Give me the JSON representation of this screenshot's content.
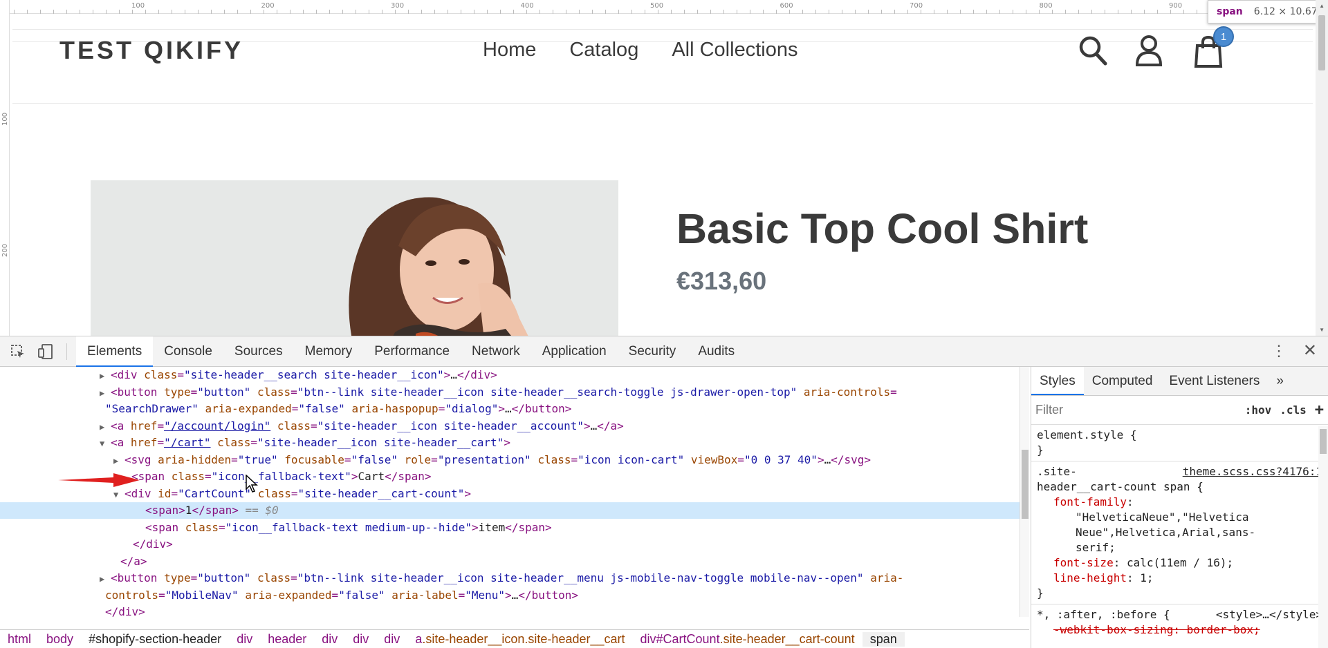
{
  "page": {
    "store_name": "TEST QIKIFY",
    "nav": [
      "Home",
      "Catalog",
      "All Collections"
    ],
    "cart_count": "1",
    "product_title": "Basic Top Cool Shirt",
    "product_price": "€313,60"
  },
  "rulers": {
    "top": [
      "100",
      "200",
      "300",
      "400",
      "500",
      "600",
      "700",
      "800",
      "900"
    ],
    "left": [
      "100",
      "200"
    ]
  },
  "inspector_tooltip": {
    "tag": "span",
    "dimensions": "6.12 × 10.67"
  },
  "devtools": {
    "tabs": [
      "Elements",
      "Console",
      "Sources",
      "Memory",
      "Performance",
      "Network",
      "Application",
      "Security",
      "Audits"
    ],
    "active_tab": "Elements",
    "dom_lines": [
      {
        "t": [
          [
            "tri",
            "▶"
          ],
          [
            "tag",
            "<div "
          ],
          [
            "attr",
            "class"
          ],
          [
            "tag",
            "="
          ],
          [
            "val",
            "\"site-header__search site-header__icon\""
          ],
          [
            "tag",
            ">"
          ],
          [
            "text",
            "…"
          ],
          [
            "tag",
            "</div>"
          ]
        ]
      },
      {
        "t": [
          [
            "tri",
            "▶"
          ],
          [
            "tag",
            "<button "
          ],
          [
            "attr",
            "type"
          ],
          [
            "tag",
            "="
          ],
          [
            "val",
            "\"button\""
          ],
          [
            "tag",
            " "
          ],
          [
            "attr",
            "class"
          ],
          [
            "tag",
            "="
          ],
          [
            "val",
            "\"btn--link site-header__icon site-header__search-toggle js-drawer-open-top\""
          ],
          [
            "tag",
            " "
          ],
          [
            "attr",
            "aria-controls"
          ],
          [
            "tag",
            "="
          ]
        ]
      },
      {
        "t": [
          [
            "val",
            "\"SearchDrawer\""
          ],
          [
            "tag",
            " "
          ],
          [
            "attr",
            "aria-expanded"
          ],
          [
            "tag",
            "="
          ],
          [
            "val",
            "\"false\""
          ],
          [
            "tag",
            " "
          ],
          [
            "attr",
            "aria-haspopup"
          ],
          [
            "tag",
            "="
          ],
          [
            "val",
            "\"dialog\""
          ],
          [
            "tag",
            ">"
          ],
          [
            "text",
            "…"
          ],
          [
            "tag",
            "</button>"
          ]
        ]
      },
      {
        "t": [
          [
            "tri",
            "▶"
          ],
          [
            "tag",
            "<a "
          ],
          [
            "attr",
            "href"
          ],
          [
            "tag",
            "="
          ],
          [
            "link",
            "\"/account/login\""
          ],
          [
            "tag",
            " "
          ],
          [
            "attr",
            "class"
          ],
          [
            "tag",
            "="
          ],
          [
            "val",
            "\"site-header__icon site-header__account\""
          ],
          [
            "tag",
            ">"
          ],
          [
            "text",
            "…"
          ],
          [
            "tag",
            "</a>"
          ]
        ]
      },
      {
        "t": [
          [
            "tri",
            "▼"
          ],
          [
            "tag",
            "<a "
          ],
          [
            "attr",
            "href"
          ],
          [
            "tag",
            "="
          ],
          [
            "link",
            "\"/cart\""
          ],
          [
            "tag",
            " "
          ],
          [
            "attr",
            "class"
          ],
          [
            "tag",
            "="
          ],
          [
            "val",
            "\"site-header__icon site-header__cart\""
          ],
          [
            "tag",
            ">"
          ]
        ]
      },
      {
        "t": [
          [
            "tri",
            "▶"
          ],
          [
            "tag",
            "<svg "
          ],
          [
            "attr",
            "aria-hidden"
          ],
          [
            "tag",
            "="
          ],
          [
            "val",
            "\"true\""
          ],
          [
            "tag",
            " "
          ],
          [
            "attr",
            "focusable"
          ],
          [
            "tag",
            "="
          ],
          [
            "val",
            "\"false\""
          ],
          [
            "tag",
            " "
          ],
          [
            "attr",
            "role"
          ],
          [
            "tag",
            "="
          ],
          [
            "val",
            "\"presentation\""
          ],
          [
            "tag",
            " "
          ],
          [
            "attr",
            "class"
          ],
          [
            "tag",
            "="
          ],
          [
            "val",
            "\"icon icon-cart\""
          ],
          [
            "tag",
            " "
          ],
          [
            "attr",
            "viewBox"
          ],
          [
            "tag",
            "="
          ],
          [
            "val",
            "\"0 0 37 40\""
          ],
          [
            "tag",
            ">"
          ],
          [
            "text",
            "…"
          ],
          [
            "tag",
            "</svg>"
          ]
        ]
      },
      {
        "t": [
          [
            "tag",
            "<span "
          ],
          [
            "attr",
            "class"
          ],
          [
            "tag",
            "="
          ],
          [
            "val",
            "\"icon__fallback-text\""
          ],
          [
            "tag",
            ">"
          ],
          [
            "text",
            "Cart"
          ],
          [
            "tag",
            "</span>"
          ]
        ]
      },
      {
        "t": [
          [
            "tri",
            "▼"
          ],
          [
            "tag",
            "<div "
          ],
          [
            "attr",
            "id"
          ],
          [
            "tag",
            "="
          ],
          [
            "val",
            "\"CartCount\""
          ],
          [
            "tag",
            " "
          ],
          [
            "attr",
            "class"
          ],
          [
            "tag",
            "="
          ],
          [
            "val",
            "\"site-header__cart-count\""
          ],
          [
            "tag",
            ">"
          ]
        ]
      },
      {
        "t": [
          [
            "tag",
            "<span>"
          ],
          [
            "text",
            "1"
          ],
          [
            "tag",
            "</span>"
          ],
          [
            "eq0",
            " == $0"
          ]
        ]
      },
      {
        "t": [
          [
            "tag",
            "<span "
          ],
          [
            "attr",
            "class"
          ],
          [
            "tag",
            "="
          ],
          [
            "val",
            "\"icon__fallback-text medium-up--hide\""
          ],
          [
            "tag",
            ">"
          ],
          [
            "text",
            "item"
          ],
          [
            "tag",
            "</span>"
          ]
        ]
      },
      {
        "t": [
          [
            "tag",
            "</div>"
          ]
        ]
      },
      {
        "t": [
          [
            "tag",
            "</a>"
          ]
        ]
      },
      {
        "t": [
          [
            "tri",
            "▶"
          ],
          [
            "tag",
            "<button "
          ],
          [
            "attr",
            "type"
          ],
          [
            "tag",
            "="
          ],
          [
            "val",
            "\"button\""
          ],
          [
            "tag",
            " "
          ],
          [
            "attr",
            "class"
          ],
          [
            "tag",
            "="
          ],
          [
            "val",
            "\"btn--link site-header__icon site-header__menu js-mobile-nav-toggle mobile-nav--open\""
          ],
          [
            "tag",
            " "
          ],
          [
            "attr",
            "aria-"
          ]
        ]
      },
      {
        "t": [
          [
            "attr",
            "controls"
          ],
          [
            "tag",
            "="
          ],
          [
            "val",
            "\"MobileNav\""
          ],
          [
            "tag",
            " "
          ],
          [
            "attr",
            "aria-expanded"
          ],
          [
            "tag",
            "="
          ],
          [
            "val",
            "\"false\""
          ],
          [
            "tag",
            " "
          ],
          [
            "attr",
            "aria-label"
          ],
          [
            "tag",
            "="
          ],
          [
            "val",
            "\"Menu\""
          ],
          [
            "tag",
            ">"
          ],
          [
            "text",
            "…"
          ],
          [
            "tag",
            "</button>"
          ]
        ]
      },
      {
        "t": [
          [
            "tag",
            "</div>"
          ]
        ]
      },
      {
        "t": [
          [
            "tag",
            "</div>"
          ]
        ]
      }
    ],
    "breadcrumbs": [
      {
        "tag": "html",
        "cls": ""
      },
      {
        "tag": "body",
        "cls": ""
      },
      {
        "tag": "#shopify-section-header",
        "cls": "",
        "plain": true
      },
      {
        "tag": "div",
        "cls": ""
      },
      {
        "tag": "header",
        "cls": ""
      },
      {
        "tag": "div",
        "cls": ""
      },
      {
        "tag": "div",
        "cls": ""
      },
      {
        "tag": "div",
        "cls": ""
      },
      {
        "tag": "a",
        "cls": ".site-header__icon.site-header__cart"
      },
      {
        "tag": "div#CartCount",
        "cls": ".site-header__cart-count"
      },
      {
        "tag": "span",
        "cls": "",
        "current": true
      }
    ],
    "styles_tabs": [
      "Styles",
      "Computed",
      "Event Listeners",
      "»"
    ],
    "filter_placeholder": "Filter",
    "hov": ":hov",
    "cls": ".cls",
    "plus": "+",
    "element_style": "element.style {",
    "close_brace": "}",
    "rule_selector_1": ".site-",
    "rule_selector_2": "header__cart-count span {",
    "rule_source": "theme.scss.css?4176:1",
    "font_family_prop": "font-family",
    "font_family_val_1": "\"HelveticaNeue\",\"Helvetica",
    "font_family_val_2": "Neue\",Helvetica,Arial,sans-",
    "font_family_val_3": "serif;",
    "font_size_prop": "font-size",
    "font_size_val": "calc(11em / 16);",
    "line_height_prop": "line-height",
    "line_height_val": "1;",
    "universal_selector": "*, :after, :before {",
    "universal_source": "<style>…</style>",
    "box_sizing": "-webkit-box-sizing: border-box;"
  },
  "colors": {
    "accent": "#1a73e8",
    "badge": "#4a8bd1",
    "selected_row": "#cfe8fc",
    "arrow": "#e0201f"
  }
}
